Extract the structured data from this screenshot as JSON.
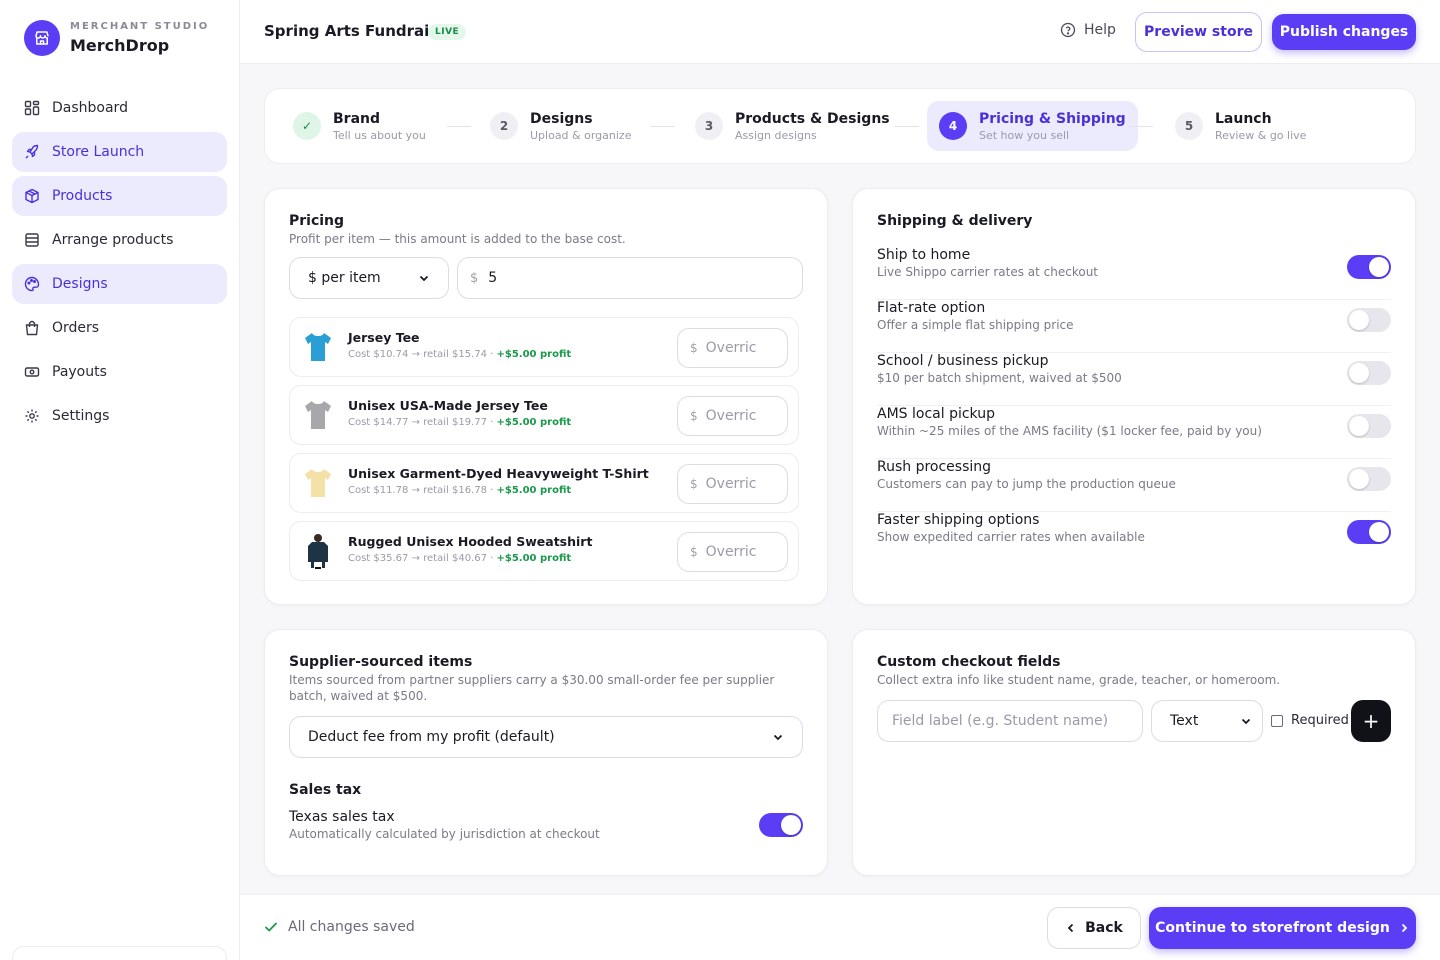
{
  "brand": {
    "sub": "MERCHANT STUDIO",
    "name": "MerchDrop",
    "icon": "storefront-icon"
  },
  "sidebar": {
    "items": [
      {
        "label": "Dashboard",
        "icon": "grid-icon",
        "active": false
      },
      {
        "label": "Store Launch",
        "icon": "rocket-icon",
        "active": true
      },
      {
        "label": "Products",
        "icon": "box-icon",
        "active": true
      },
      {
        "label": "Arrange products",
        "icon": "list-icon",
        "active": false
      },
      {
        "label": "Designs",
        "icon": "palette-icon",
        "active": true
      },
      {
        "label": "Orders",
        "icon": "bag-icon",
        "active": false
      },
      {
        "label": "Payouts",
        "icon": "cash-icon",
        "active": false
      },
      {
        "label": "Settings",
        "icon": "gear-icon",
        "active": false
      }
    ]
  },
  "header": {
    "store_title": "Spring Arts Fundraiser",
    "status_badge": "LIVE",
    "help_label": "Help",
    "preview_label": "Preview store",
    "publish_label": "Publish changes"
  },
  "stepper": {
    "steps": [
      {
        "num": "✓",
        "title": "Brand",
        "sub": "Tell us about you",
        "state": "done"
      },
      {
        "num": "2",
        "title": "Designs",
        "sub": "Upload & organize",
        "state": "todo"
      },
      {
        "num": "3",
        "title": "Products & Designs",
        "sub": "Assign designs",
        "state": "todo"
      },
      {
        "num": "4",
        "title": "Pricing & Shipping",
        "sub": "Set how you sell",
        "state": "current"
      },
      {
        "num": "5",
        "title": "Launch",
        "sub": "Review & go live",
        "state": "todo"
      }
    ]
  },
  "pricing": {
    "title": "Pricing",
    "desc": "Profit per item — this amount is added to the base cost.",
    "mode_select": "$ per item",
    "currency_symbol": "$",
    "amount": "5",
    "override_placeholder": "Overric",
    "products": [
      {
        "name": "Jersey Tee",
        "meta": "Cost $10.74 → retail $15.74 · ",
        "profit": "+$5.00 profit",
        "color": "#2a9fd6"
      },
      {
        "name": "Unisex USA-Made Jersey Tee",
        "meta": "Cost $14.77 → retail $19.77 · ",
        "profit": "+$5.00 profit",
        "color": "#a8a8ac"
      },
      {
        "name": "Unisex Garment-Dyed Heavyweight T-Shirt",
        "meta": "Cost $11.78 → retail $16.78 · ",
        "profit": "+$5.00 profit",
        "color": "#f3e1a8"
      },
      {
        "name": "Rugged Unisex Hooded Sweatshirt",
        "meta": "Cost $35.67 → retail $40.67 · ",
        "profit": "+$5.00 profit",
        "color": "#1e3446"
      }
    ]
  },
  "shipping": {
    "title": "Shipping & delivery",
    "options": [
      {
        "title": "Ship to home",
        "desc": "Live Shippo carrier rates at checkout",
        "on": true
      },
      {
        "title": "Flat-rate option",
        "desc": "Offer a simple flat shipping price",
        "on": false
      },
      {
        "title": "School / business pickup",
        "desc": "$10 per batch shipment, waived at $500",
        "on": false
      },
      {
        "title": "AMS local pickup",
        "desc": "Within ~25 miles of the AMS facility ($1 locker fee, paid by you)",
        "on": false
      },
      {
        "title": "Rush processing",
        "desc": "Customers can pay to jump the production queue",
        "on": false
      },
      {
        "title": "Faster shipping options",
        "desc": "Show expedited carrier rates when available",
        "on": true
      }
    ]
  },
  "supplier": {
    "title": "Supplier-sourced items",
    "desc": "Items sourced from partner suppliers carry a $30.00 small-order fee per supplier batch, waived at $500.",
    "fee_select": "Deduct fee from my profit (default)",
    "tax_title": "Sales tax",
    "tax_name": "Texas sales tax",
    "tax_desc": "Automatically calculated by jurisdiction at checkout",
    "tax_on": true
  },
  "checkout": {
    "title": "Custom checkout fields",
    "desc": "Collect extra info like student name, grade, teacher, or homeroom.",
    "field_placeholder": "Field label (e.g. Student name)",
    "type_select": "Text",
    "required_label": "Required",
    "add_label": "+"
  },
  "footer": {
    "saved_label": "All changes saved",
    "back_label": "Back",
    "continue_label": "Continue to storefront design"
  },
  "colors": {
    "accent": "#5a3df5",
    "accent_light": "#ecebfe",
    "success": "#1a9a4a"
  }
}
